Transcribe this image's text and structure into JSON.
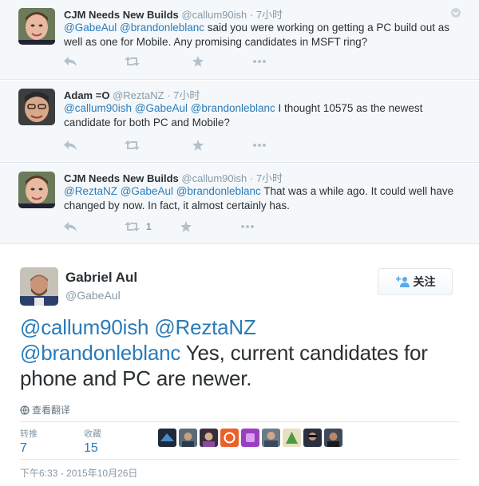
{
  "replies": [
    {
      "name": "CJM Needs New Builds",
      "handle": "@callum90ish",
      "dot": "·",
      "time": "7小时",
      "mentions": "@GabeAul @brandonleblanc",
      "text": " said you were working on getting a PC build out as well as one for Mobile. Any promising candidates in MSFT ring?",
      "retweet_count": "",
      "more_icon": "ellipsis-icon"
    },
    {
      "name": "Adam =O",
      "handle": "@ReztaNZ",
      "dot": "·",
      "time": "7小时",
      "mentions": "@callum90ish @GabeAul @brandonleblanc",
      "text": " I thought 10575 as the newest candidate for both PC and Mobile?",
      "retweet_count": ""
    },
    {
      "name": "CJM Needs New Builds",
      "handle": "@callum90ish",
      "dot": "·",
      "time": "7小时",
      "mentions": "@ReztaNZ @GabeAul @brandonleblanc",
      "text": " That was a while ago. It could well have changed by now. In fact, it almost certainly has.",
      "retweet_count": "1"
    }
  ],
  "main": {
    "name": "Gabriel Aul",
    "handle": "@GabeAul",
    "follow_label": "关注",
    "mention_a": "@callum90ish",
    "mention_b": "@ReztaNZ",
    "mention_c": "@brandonleblanc",
    "text": " Yes, current candidates for phone and PC are newer.",
    "translate_label": "查看翻译",
    "retweets_label": "转推",
    "retweets_value": "7",
    "favorites_label": "收藏",
    "favorites_value": "15",
    "timestamp": "下午6:33 - 2015年10月26日"
  },
  "colors": {
    "link": "#2b7bb9",
    "muted": "#8899a6",
    "reply_bg": "#f5f8fa",
    "action_icon": "#b5c1ca"
  }
}
